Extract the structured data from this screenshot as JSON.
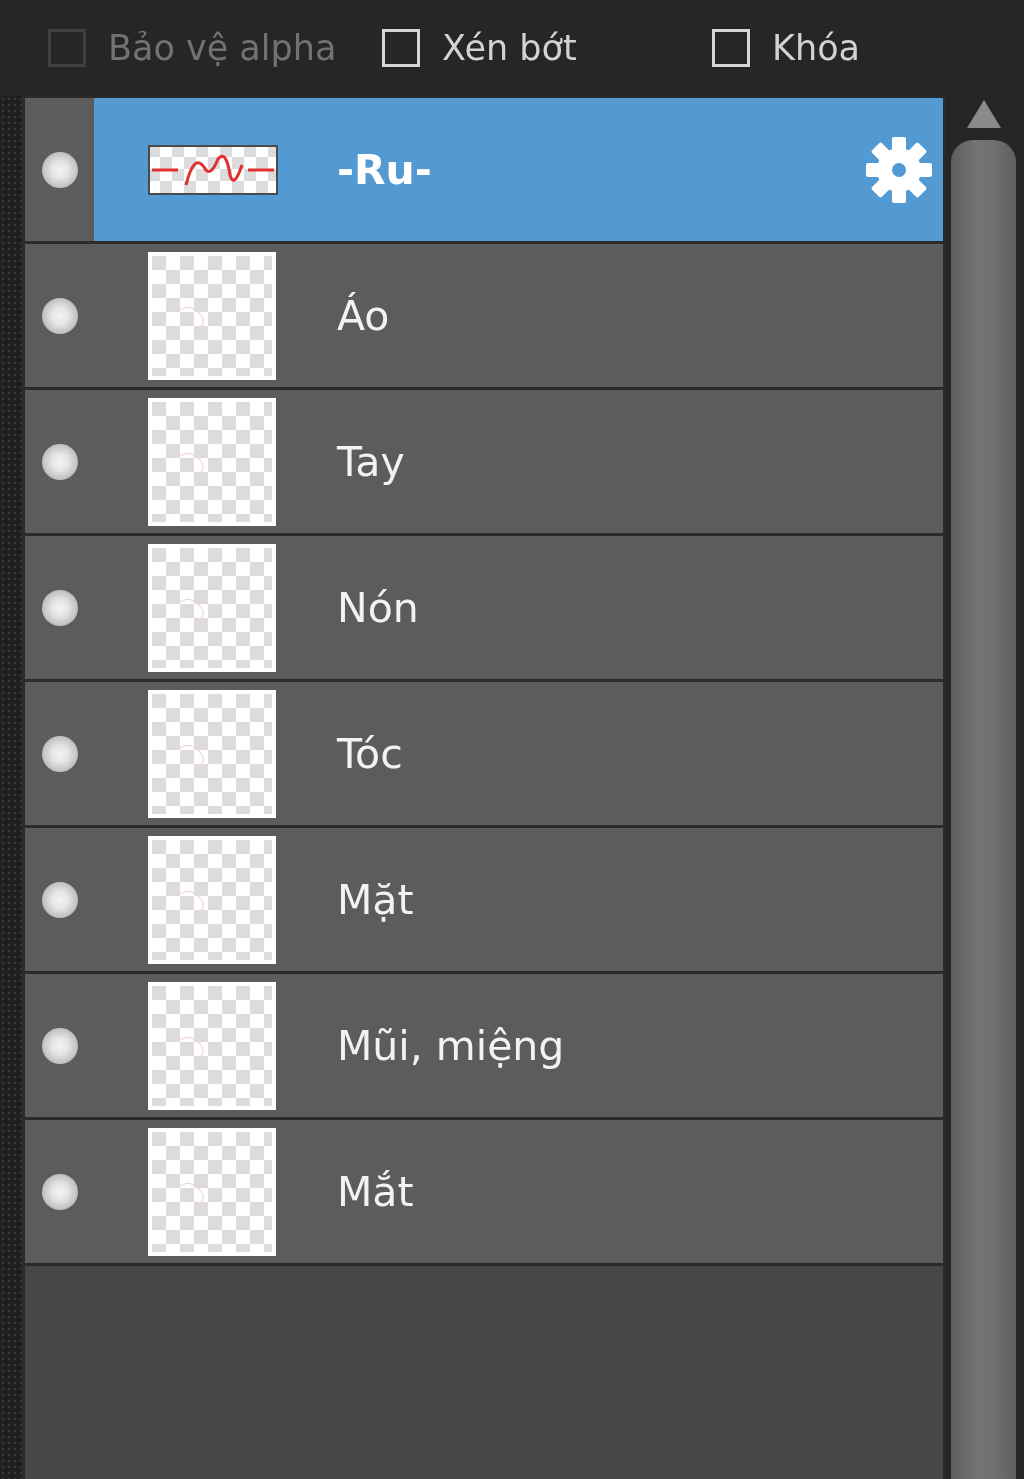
{
  "options": [
    {
      "label": "Bảo vệ alpha",
      "checked": false,
      "disabled": true
    },
    {
      "label": "Xén bớt",
      "checked": false,
      "disabled": false
    },
    {
      "label": "Khóa",
      "checked": false,
      "disabled": false
    }
  ],
  "layers": [
    {
      "name": "-Ru-",
      "kind": "text",
      "selected": true,
      "visible": true
    },
    {
      "name": "Áo",
      "kind": "raster",
      "selected": false,
      "visible": true
    },
    {
      "name": "Tay",
      "kind": "raster",
      "selected": false,
      "visible": true
    },
    {
      "name": "Nón",
      "kind": "raster",
      "selected": false,
      "visible": true
    },
    {
      "name": "Tóc",
      "kind": "raster",
      "selected": false,
      "visible": true
    },
    {
      "name": "Mặt",
      "kind": "raster",
      "selected": false,
      "visible": true
    },
    {
      "name": "Mũi, miệng",
      "kind": "raster",
      "selected": false,
      "visible": true
    },
    {
      "name": "Mắt",
      "kind": "raster",
      "selected": false,
      "visible": true
    }
  ]
}
